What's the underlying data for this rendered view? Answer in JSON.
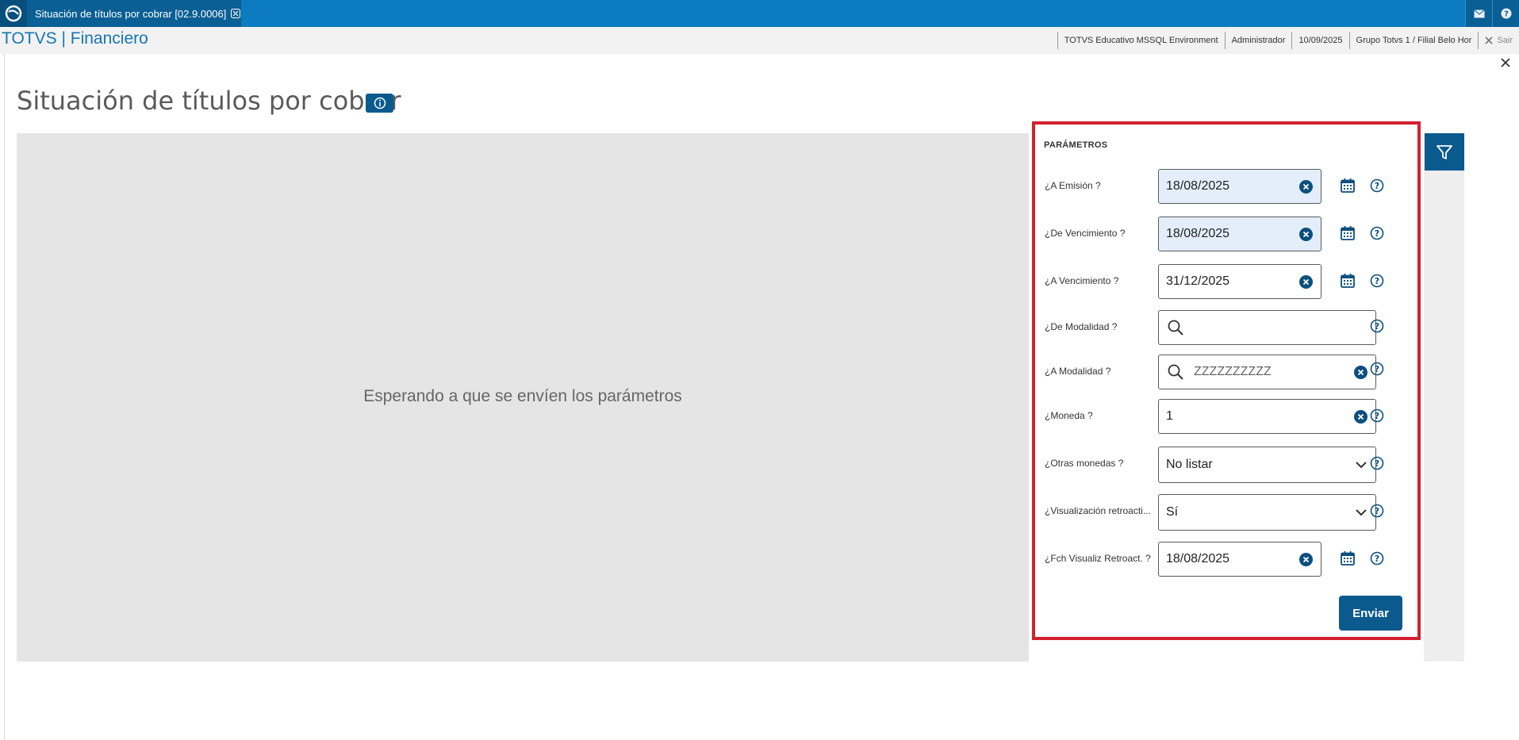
{
  "tab": {
    "title": "Situación de títulos por cobrar [02.9.0006]"
  },
  "header": {
    "app_title": "TOTVS | Financiero",
    "environment": "TOTVS Educativo MSSQL Environment",
    "user": "Administrador",
    "date": "10/09/2025",
    "branch": "Grupo Totvs 1 / Filial Belo Hor",
    "logout_label": "Sair"
  },
  "page": {
    "title": "Situación de títulos por cobrar",
    "placeholder": "Esperando a que se envíen los parámetros"
  },
  "params": {
    "heading": "PARÁMETROS",
    "rows": [
      {
        "label": "¿A Emisión ?",
        "value": "18/08/2025"
      },
      {
        "label": "¿De Vencimiento ?",
        "value": "18/08/2025"
      },
      {
        "label": "¿A Vencimiento ?",
        "value": "31/12/2025"
      },
      {
        "label": "¿De Modalidad ?",
        "value": ""
      },
      {
        "label": "¿A Modalidad ?",
        "value": "ZZZZZZZZZZ"
      },
      {
        "label": "¿Moneda ?",
        "value": "1"
      },
      {
        "label": "¿Otras monedas ?",
        "value": "No listar"
      },
      {
        "label": "¿Visualización retroacti...",
        "value": "Sí"
      },
      {
        "label": "¿Fch Visualiz Retroact. ?",
        "value": "18/08/2025"
      }
    ],
    "send_label": "Enviar"
  },
  "colors": {
    "topbar": "#0c7bbf",
    "primary": "#0b5a8e",
    "highlight_border": "#d32030",
    "filled_field": "#e4eefa"
  }
}
